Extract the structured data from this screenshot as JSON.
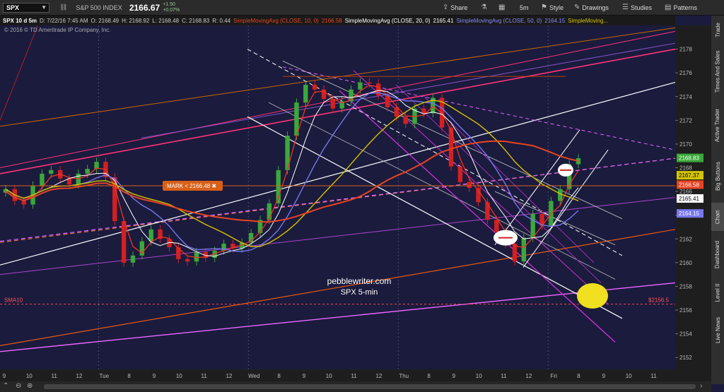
{
  "toolbar": {
    "symbol": "SPX",
    "description": "S&P 500 INDEX",
    "last_price": "2166.67",
    "change_points": "+1.50",
    "change_pct": "+0.07%",
    "share_label": "Share",
    "interval_label": "5m",
    "style_label": "Style",
    "drawings_label": "Drawings",
    "studies_label": "Studies",
    "patterns_label": "Patterns"
  },
  "infobar": {
    "symbol_period": "SPX 10 d 5m",
    "date": "D: 7/22/16 7:45 AM",
    "open": "O: 2168.49",
    "high": "H: 2168.92",
    "low": "L: 2168.48",
    "close": "C: 2168.83",
    "range": "R: 0.44",
    "sma10_label": "SimpleMovingAvg (CLOSE, 10, 0)",
    "sma10_value": "2166.58",
    "sma20_label": "SimpleMovingAvg (CLOSE, 20, 0)",
    "sma20_value": "2165.41",
    "sma50_label": "SimpleMovingAvg (CLOSE, 50, 0)",
    "sma50_value": "2164.15",
    "sma_more_label": "SimpleMoving..."
  },
  "copyright": "© 2016 © TD Ameritrade IP Company, Inc.",
  "right_tabs": [
    "Trade",
    "Times And Sales",
    "Active Trader",
    "Big Buttons",
    "Chart",
    "Dashboard",
    "Level II",
    "Live News"
  ],
  "chart_data": {
    "type": "candlestick",
    "title": "pebblewriter.com",
    "subtitle": "SPX 5-min",
    "ylim": [
      2151,
      2180
    ],
    "y_ticks": [
      2152,
      2154,
      2156,
      2158,
      2160,
      2162,
      2164,
      2166,
      2168,
      2170,
      2172,
      2174,
      2176,
      2178
    ],
    "x_tick_labels": [
      "9",
      "10",
      "11",
      "12",
      "Tue",
      "8",
      "9",
      "10",
      "11",
      "12",
      "Wed",
      "8",
      "9",
      "10",
      "11",
      "12",
      "Thu",
      "8",
      "9",
      "10",
      "11",
      "12",
      "Fri",
      "8",
      "9",
      "10",
      "11"
    ],
    "mark": {
      "label": "MARK < 2166.48",
      "value": 2166.48
    },
    "sma10_line": {
      "label": "SMA10",
      "value": 2156.5,
      "price_label": "$2156.5"
    },
    "price_labels": [
      {
        "text": "2168.83",
        "value": 2168.83,
        "color": "#3aa83a"
      },
      {
        "text": "2167.37",
        "value": 2167.37,
        "color": "#d4c400"
      },
      {
        "text": "2166.58",
        "value": 2166.58,
        "color": "#e84422"
      },
      {
        "text": "2165.41",
        "value": 2165.41,
        "color": "#ffffff"
      },
      {
        "text": "2164.15",
        "value": 2164.15,
        "color": "#7777ee"
      }
    ],
    "series": [
      {
        "name": "SPX",
        "close": [
          2166.2,
          2165.2,
          2164.9,
          2166.5,
          2167.5,
          2167.8,
          2167.1,
          2166.6,
          2167.5,
          2167.9,
          2168.5,
          2167.2,
          2163.5,
          2160.0,
          2160.6,
          2161.8,
          2162.8,
          2162.0,
          2161.3,
          2160.3,
          2160.1,
          2160.9,
          2160.4,
          2161.0,
          2161.6,
          2161.2,
          2161.7,
          2162.5,
          2163.6,
          2165.0,
          2167.8,
          2170.7,
          2173.5,
          2175.0,
          2174.6,
          2173.8,
          2173.0,
          2173.6,
          2174.6,
          2175.2,
          2175.1,
          2174.1,
          2173.1,
          2172.3,
          2171.7,
          2173.0,
          2172.6,
          2173.9,
          2171.4,
          2168.1,
          2166.8,
          2166.3,
          2165.1,
          2163.6,
          2162.6,
          2161.6,
          2160.1,
          2162.1,
          2164.1,
          2163.1,
          2165.2,
          2166.2,
          2168.3,
          2168.8
        ]
      },
      {
        "name": "SMA 10",
        "value": 2166.58,
        "color": "#e84422"
      },
      {
        "name": "SMA 20",
        "value": 2165.41,
        "color": "#ffffff"
      },
      {
        "name": "SMA 50",
        "value": 2164.15,
        "color": "#7777ee"
      },
      {
        "name": "SMA",
        "value": 2167.37,
        "color": "#d4c400"
      }
    ],
    "colors": {
      "background": "#1b1b3e",
      "up": "#3aa83a",
      "down": "#d42020",
      "mark": "#d86018"
    }
  }
}
